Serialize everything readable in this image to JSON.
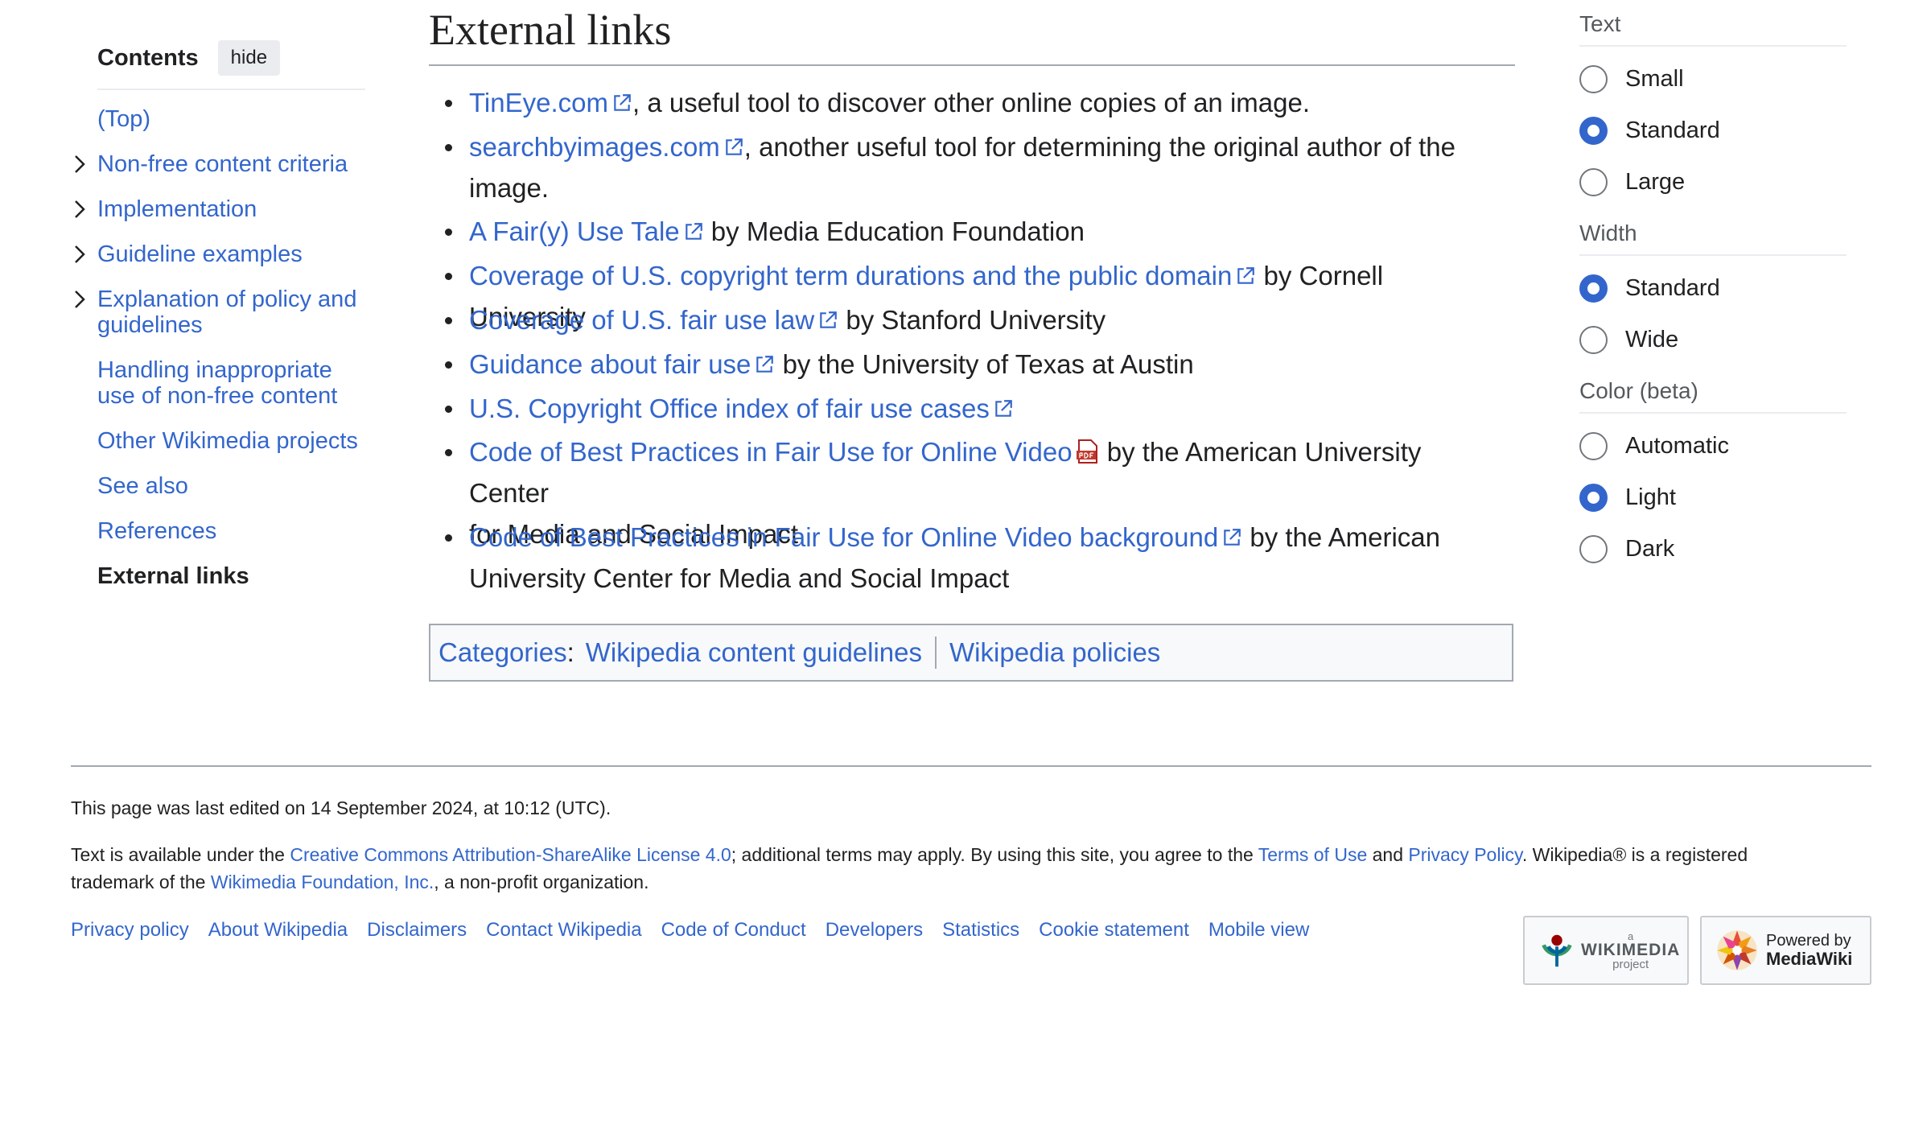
{
  "toc": {
    "title": "Contents",
    "hide_label": "hide",
    "items": [
      {
        "label": "(Top)"
      },
      {
        "label": "Non-free content criteria"
      },
      {
        "label": "Implementation"
      },
      {
        "label": "Guideline examples"
      },
      {
        "label": "Explanation of policy and guidelines"
      },
      {
        "label": "Handling inappropriate use of non-free content"
      },
      {
        "label": "Other Wikimedia projects"
      },
      {
        "label": "See also"
      },
      {
        "label": "References"
      },
      {
        "label": "External links"
      }
    ]
  },
  "main": {
    "heading": "External links",
    "links": [
      {
        "link": "TinEye.com",
        "text": ", a useful tool to discover other online copies of an image."
      },
      {
        "link": "searchbyimages.com",
        "text": ", another useful tool for determining the original author of the",
        "text2": "image."
      },
      {
        "link": "A Fair(y) Use Tale",
        "text": " by Media Education Foundation"
      },
      {
        "link": "Coverage of U.S. copyright term durations and the public domain",
        "text": " by Cornell University"
      },
      {
        "link": "Coverage of U.S. fair use law",
        "text": " by Stanford University"
      },
      {
        "link": "Guidance about fair use",
        "text": " by the University of Texas at Austin"
      },
      {
        "link": "U.S. Copyright Office index of fair use cases",
        "text": ""
      },
      {
        "link": "Code of Best Practices in Fair Use for Online Video",
        "text": " by the American University Center",
        "text2": "for Media and Social Impact"
      },
      {
        "link": "Code of Best Practices in Fair Use for Online Video background",
        "text": " by the American",
        "text2": "University Center for Media and Social Impact"
      }
    ],
    "categories": {
      "label": "Categories",
      "colon": ":",
      "items": [
        "Wikipedia content guidelines",
        "Wikipedia policies"
      ]
    }
  },
  "appearance": {
    "text_title": "Text",
    "text_options": [
      "Small",
      "Standard",
      "Large"
    ],
    "width_title": "Width",
    "width_options": [
      "Standard",
      "Wide"
    ],
    "color_title": "Color (beta)",
    "color_options": [
      "Automatic",
      "Light",
      "Dark"
    ]
  },
  "footer": {
    "last_edited": "This page was last edited on 14 September 2024, at 10:12 (UTC).",
    "license_prefix": "Text is available under the ",
    "license_link": "Creative Commons Attribution-ShareAlike License 4.0",
    "license_mid": "; additional terms may apply. By using this site, you agree to the ",
    "terms_link": "Terms of Use",
    "and": " and ",
    "privacy_link": "Privacy Policy",
    "license_suffix": ". Wikipedia® is a registered",
    "line2_prefix": "trademark of the ",
    "wmf_link": "Wikimedia Foundation, Inc.",
    "line2_suffix": ", a non-profit organization.",
    "links": [
      "Privacy policy",
      "About Wikipedia",
      "Disclaimers",
      "Contact Wikipedia",
      "Code of Conduct",
      "Developers",
      "Statistics",
      "Cookie statement",
      "Mobile view"
    ],
    "wikimedia_badge": {
      "small": "a",
      "big": "WIKIMEDIA",
      "sub": "project"
    },
    "mediawiki_badge": {
      "line1": "Powered by",
      "line2": "MediaWiki"
    }
  },
  "colors": {
    "link": "#3366cc",
    "text": "#202122",
    "border": "#a2a9b1",
    "radio_checked": "#3366cc"
  }
}
